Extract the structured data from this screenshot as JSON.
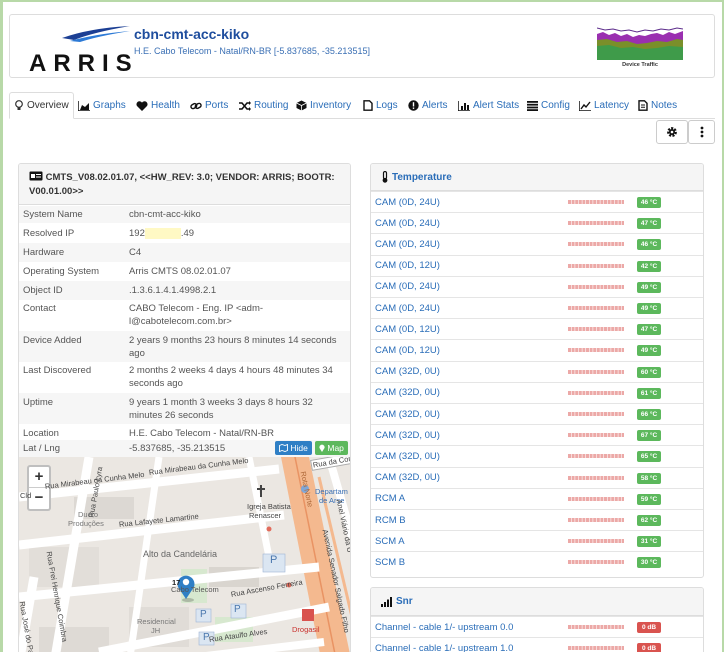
{
  "header": {
    "logo_text": "ARRIS",
    "device_name": "cbn-cmt-acc-kiko",
    "device_subtitle": "H.E. Cabo Telecom - Natal/RN-BR [-5.837685, -35.213515]",
    "traffic_label": "Device Traffic"
  },
  "tabs": [
    {
      "label": "Overview",
      "icon": "lightbulb-icon"
    },
    {
      "label": "Graphs",
      "icon": "area-chart-icon"
    },
    {
      "label": "Health",
      "icon": "heartbeat-icon"
    },
    {
      "label": "Ports",
      "icon": "link-icon"
    },
    {
      "label": "Routing",
      "icon": "random-icon"
    },
    {
      "label": "Inventory",
      "icon": "cube-icon"
    },
    {
      "label": "Logs",
      "icon": "file-icon"
    },
    {
      "label": "Alerts",
      "icon": "exclamation-circle-icon"
    },
    {
      "label": "Alert Stats",
      "icon": "bar-chart-icon"
    },
    {
      "label": "Config",
      "icon": "align-justify-icon"
    },
    {
      "label": "Latency",
      "icon": "line-chart-icon"
    },
    {
      "label": "Notes",
      "icon": "file-text-icon"
    }
  ],
  "toolbar": {
    "settings_icon": "gear-icon",
    "more_icon": "vertical-ellipsis-icon"
  },
  "device": {
    "heading": "CMTS_V08.02.01.07, <<HW_REV: 3.0; VENDOR: ARRIS; BOOTR: V00.01.00>>",
    "rows": [
      {
        "key": "System Name",
        "value": "cbn-cmt-acc-kiko"
      },
      {
        "key": "Resolved IP",
        "value_prefix": "192",
        "value_suffix": ".49"
      },
      {
        "key": "Hardware",
        "value": "C4"
      },
      {
        "key": "Operating System",
        "value": "Arris CMTS 08.02.01.07"
      },
      {
        "key": "Object ID",
        "value": ".1.3.6.1.4.1.4998.2.1"
      },
      {
        "key": "Contact",
        "value": "CABO Telecom - Eng. IP <adm-l@cabotelecom.com.br>"
      },
      {
        "key": "Device Added",
        "value": "2 years 9 months 23 hours 8 minutes 14 seconds ago"
      },
      {
        "key": "Last Discovered",
        "value": "2 months 2 weeks 4 days 4 hours 48 minutes 34 seconds ago"
      },
      {
        "key": "Uptime",
        "value": "9 years 1 month 3 weeks 3 days 8 hours 32 minutes 26 seconds"
      },
      {
        "key": "Location",
        "value": "H.E. Cabo Telecom - Natal/RN-BR"
      },
      {
        "key": "Lat / Lng",
        "value": "-5.837685, -35.213515"
      }
    ],
    "hide_button": "Hide",
    "map_button": "Map"
  },
  "map": {
    "zoom_in": "+",
    "zoom_out": "−",
    "labels": {
      "rua_mirabeau_1": "Rua Mirabeau da Cunha Melo",
      "rua_mirabeau_2": "Rua Mirabeau da Cunha Melo",
      "rua_da_conc": "Rua da Conc",
      "rua_paulo": "Rua Paulo Lyra",
      "dueto": "Dueto",
      "producoes": "Produções",
      "lafayete": "Rua Lafayete Lamartine",
      "igreja1": "Igreja Batista",
      "igreja2": "Renascer",
      "departam1": "Departam",
      "departam2": "de Arse",
      "alto": "Alto da Candelária",
      "frei": "Rua Frei Henrique Coimbra",
      "jose": "Rua José do Pa",
      "senador": "Avenida Senador Salgado Filho",
      "ascenso": "Rua Ascenso Ferreira",
      "ataulfo": "Rua Ataulfo Alves",
      "residencial1": "Residencial",
      "residencial2": "JH",
      "drogasil": "Drogasil",
      "cabo": "Cabo Telecom",
      "seventeen": "17",
      "anel": "Anel Viário da U",
      "rota": "Rota Norte",
      "edge_left": "Cld",
      "parking1": "P",
      "parking2": "P",
      "parking3": "P",
      "parking4": "P"
    }
  },
  "temperature": {
    "title": "Temperature",
    "rows": [
      {
        "name": "CAM (0D, 24U)",
        "value": "46 °C"
      },
      {
        "name": "CAM (0D, 24U)",
        "value": "47 °C"
      },
      {
        "name": "CAM (0D, 24U)",
        "value": "46 °C"
      },
      {
        "name": "CAM (0D, 12U)",
        "value": "42 °C"
      },
      {
        "name": "CAM (0D, 24U)",
        "value": "49 °C"
      },
      {
        "name": "CAM (0D, 24U)",
        "value": "49 °C"
      },
      {
        "name": "CAM (0D, 12U)",
        "value": "47 °C"
      },
      {
        "name": "CAM (0D, 12U)",
        "value": "49 °C"
      },
      {
        "name": "CAM (32D, 0U)",
        "value": "60 °C"
      },
      {
        "name": "CAM (32D, 0U)",
        "value": "61 °C"
      },
      {
        "name": "CAM (32D, 0U)",
        "value": "66 °C"
      },
      {
        "name": "CAM (32D, 0U)",
        "value": "67 °C"
      },
      {
        "name": "CAM (32D, 0U)",
        "value": "65 °C"
      },
      {
        "name": "CAM (32D, 0U)",
        "value": "58 °C"
      },
      {
        "name": "RCM A",
        "value": "59 °C"
      },
      {
        "name": "RCM B",
        "value": "62 °C"
      },
      {
        "name": "SCM A",
        "value": "31 °C"
      },
      {
        "name": "SCM B",
        "value": "30 °C"
      }
    ]
  },
  "snr": {
    "title": "Snr",
    "rows": [
      {
        "name": "Channel - cable 1/- upstream 0.0",
        "value": "0 dB"
      },
      {
        "name": "Channel - cable 1/- upstream 1.0",
        "value": "0 dB"
      }
    ]
  },
  "colors": {
    "link": "#2a6db8",
    "title": "#1f4e9e",
    "badge_green": "#5cb85c",
    "badge_red": "#d9534f",
    "sparkline": "#d9534f"
  }
}
